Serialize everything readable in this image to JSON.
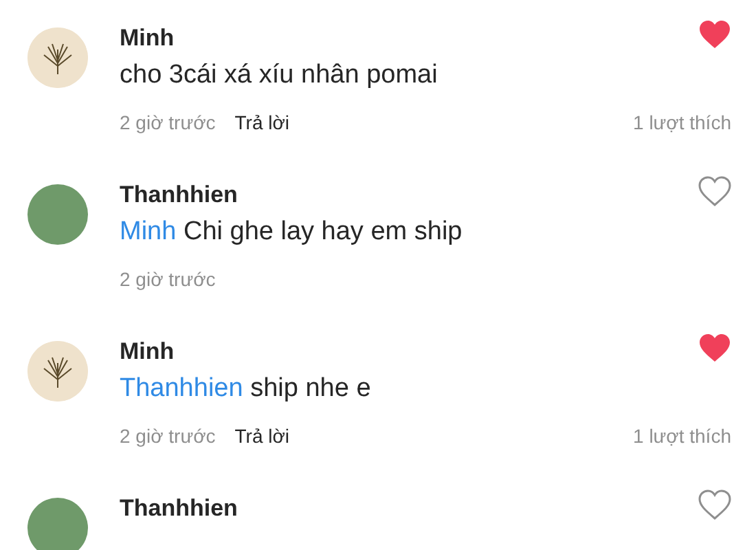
{
  "comments": [
    {
      "author": "Minh",
      "avatar": {
        "kind": "plant"
      },
      "liked": true,
      "text": "cho 3cái xá xíu nhân pomai",
      "time": "2 giờ trước",
      "reply": "Trả lời",
      "likes": "1 lượt thích"
    },
    {
      "author": "Thanhhien",
      "avatar": {
        "kind": "photo"
      },
      "liked": false,
      "mention": "Minh",
      "text": "Chi ghe lay hay em ship",
      "time": "2 giờ trước"
    },
    {
      "author": "Minh",
      "avatar": {
        "kind": "plant"
      },
      "liked": true,
      "mention": "Thanhhien",
      "text": "ship nhe e",
      "time": "2 giờ trước",
      "reply": "Trả lời",
      "likes": "1 lượt thích"
    },
    {
      "author": "Thanhhien",
      "avatar": {
        "kind": "photo"
      },
      "liked": false
    }
  ]
}
